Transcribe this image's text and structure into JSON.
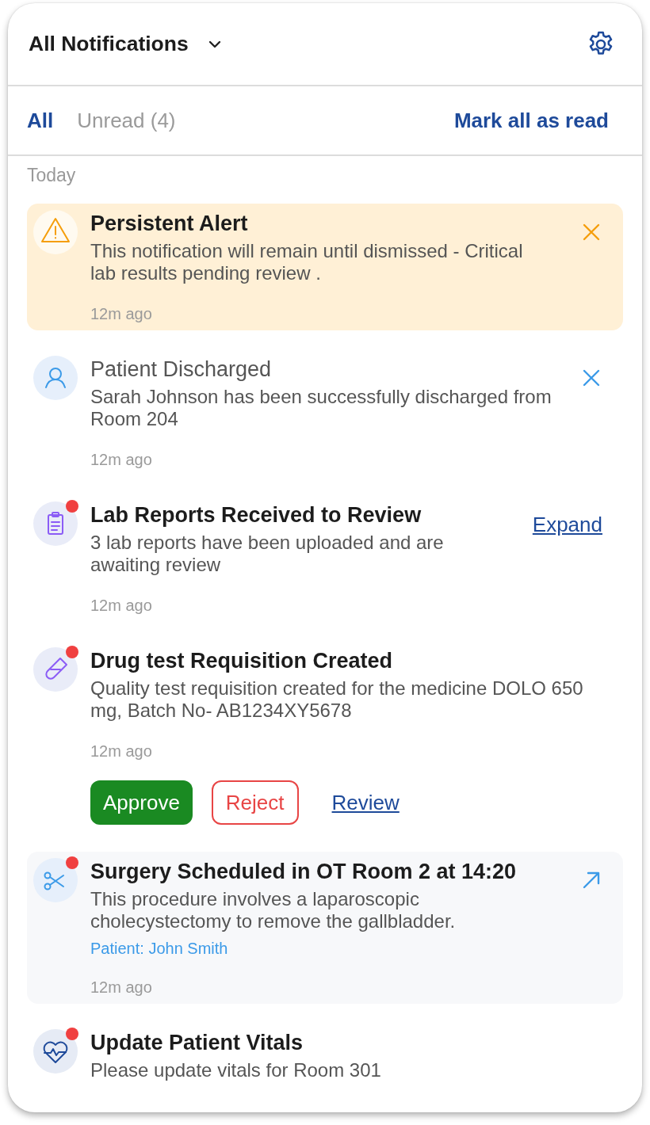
{
  "header": {
    "title": "All Notifications"
  },
  "tabs": [
    {
      "label": "All",
      "selected": true
    },
    {
      "label": "Unread (4)",
      "selected": false
    }
  ],
  "mark_all": "Mark all as read",
  "section": "Today",
  "notifications": [
    {
      "kind": "alert",
      "read": false,
      "unread_dot": false,
      "title": "Persistent Alert",
      "body": "This notification will remain until dismissed - Critical lab results pending review .",
      "time": "12m ago",
      "action": {
        "kind": "dismiss"
      }
    },
    {
      "kind": "discharge",
      "read": true,
      "unread_dot": false,
      "title": "Patient Discharged",
      "body": "Sarah Johnson has been successfully discharged from Room 204",
      "time": "12m ago",
      "action": {
        "kind": "dismiss"
      }
    },
    {
      "kind": "lab-report",
      "read": false,
      "unread_dot": true,
      "title": "Lab Reports Received to Review",
      "body": "3 lab reports have been uploaded and are awaiting review",
      "time": "12m ago",
      "action": {
        "kind": "link",
        "label": "Expand"
      }
    },
    {
      "kind": "drug-test",
      "read": false,
      "unread_dot": true,
      "title": "Drug test Requisition Created",
      "body": "Quality test requisition created for the medicine DOLO 650 mg, Batch No- AB1234XY5678",
      "time": "12m ago",
      "buttons": [
        {
          "kind": "primary",
          "label": "Approve"
        },
        {
          "kind": "outline",
          "label": "Reject"
        },
        {
          "kind": "link",
          "label": "Review"
        }
      ]
    },
    {
      "kind": "surgery",
      "read": false,
      "unread_dot": true,
      "title": "Surgery Scheduled in OT Room 2 at 14:20",
      "body": "This procedure involves a laparoscopic cholecystectomy to remove the gallbladder.",
      "patient": "Patient: John Smith",
      "time": "12m ago",
      "action": {
        "kind": "open"
      }
    },
    {
      "kind": "vitals",
      "read": false,
      "unread_dot": true,
      "title": "Update Patient Vitals",
      "body": "Please update vitals for Room 301"
    }
  ]
}
